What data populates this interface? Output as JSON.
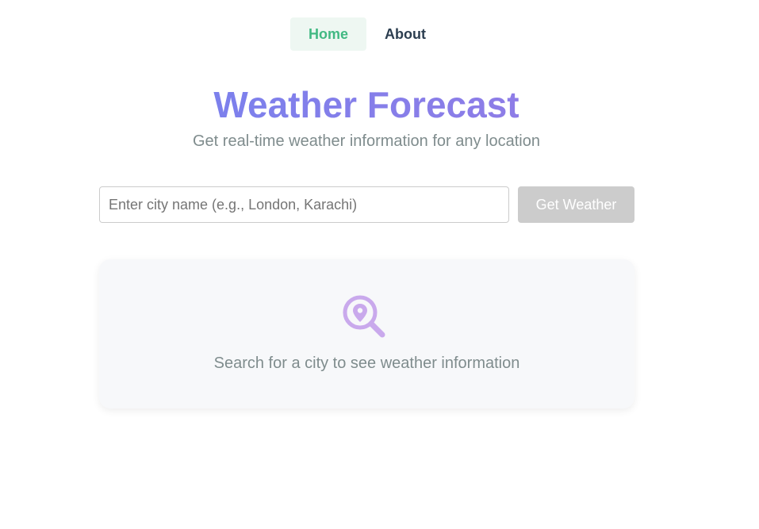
{
  "nav": {
    "items": [
      {
        "label": "Home",
        "active": true
      },
      {
        "label": "About",
        "active": false
      }
    ]
  },
  "header": {
    "title": "Weather Forecast",
    "subtitle": "Get real-time weather information for any location"
  },
  "search": {
    "value": "",
    "placeholder": "Enter city name (e.g., London, Karachi)",
    "button_label": "Get Weather"
  },
  "empty_state": {
    "icon": "search-location-icon",
    "message": "Search for a city to see weather information"
  },
  "colors": {
    "accent_green": "#42b983",
    "title_gradient_start": "#7083f0",
    "title_gradient_end": "#9a7ae3",
    "icon_color": "#c9a9ec",
    "button_disabled": "#cccccc"
  }
}
